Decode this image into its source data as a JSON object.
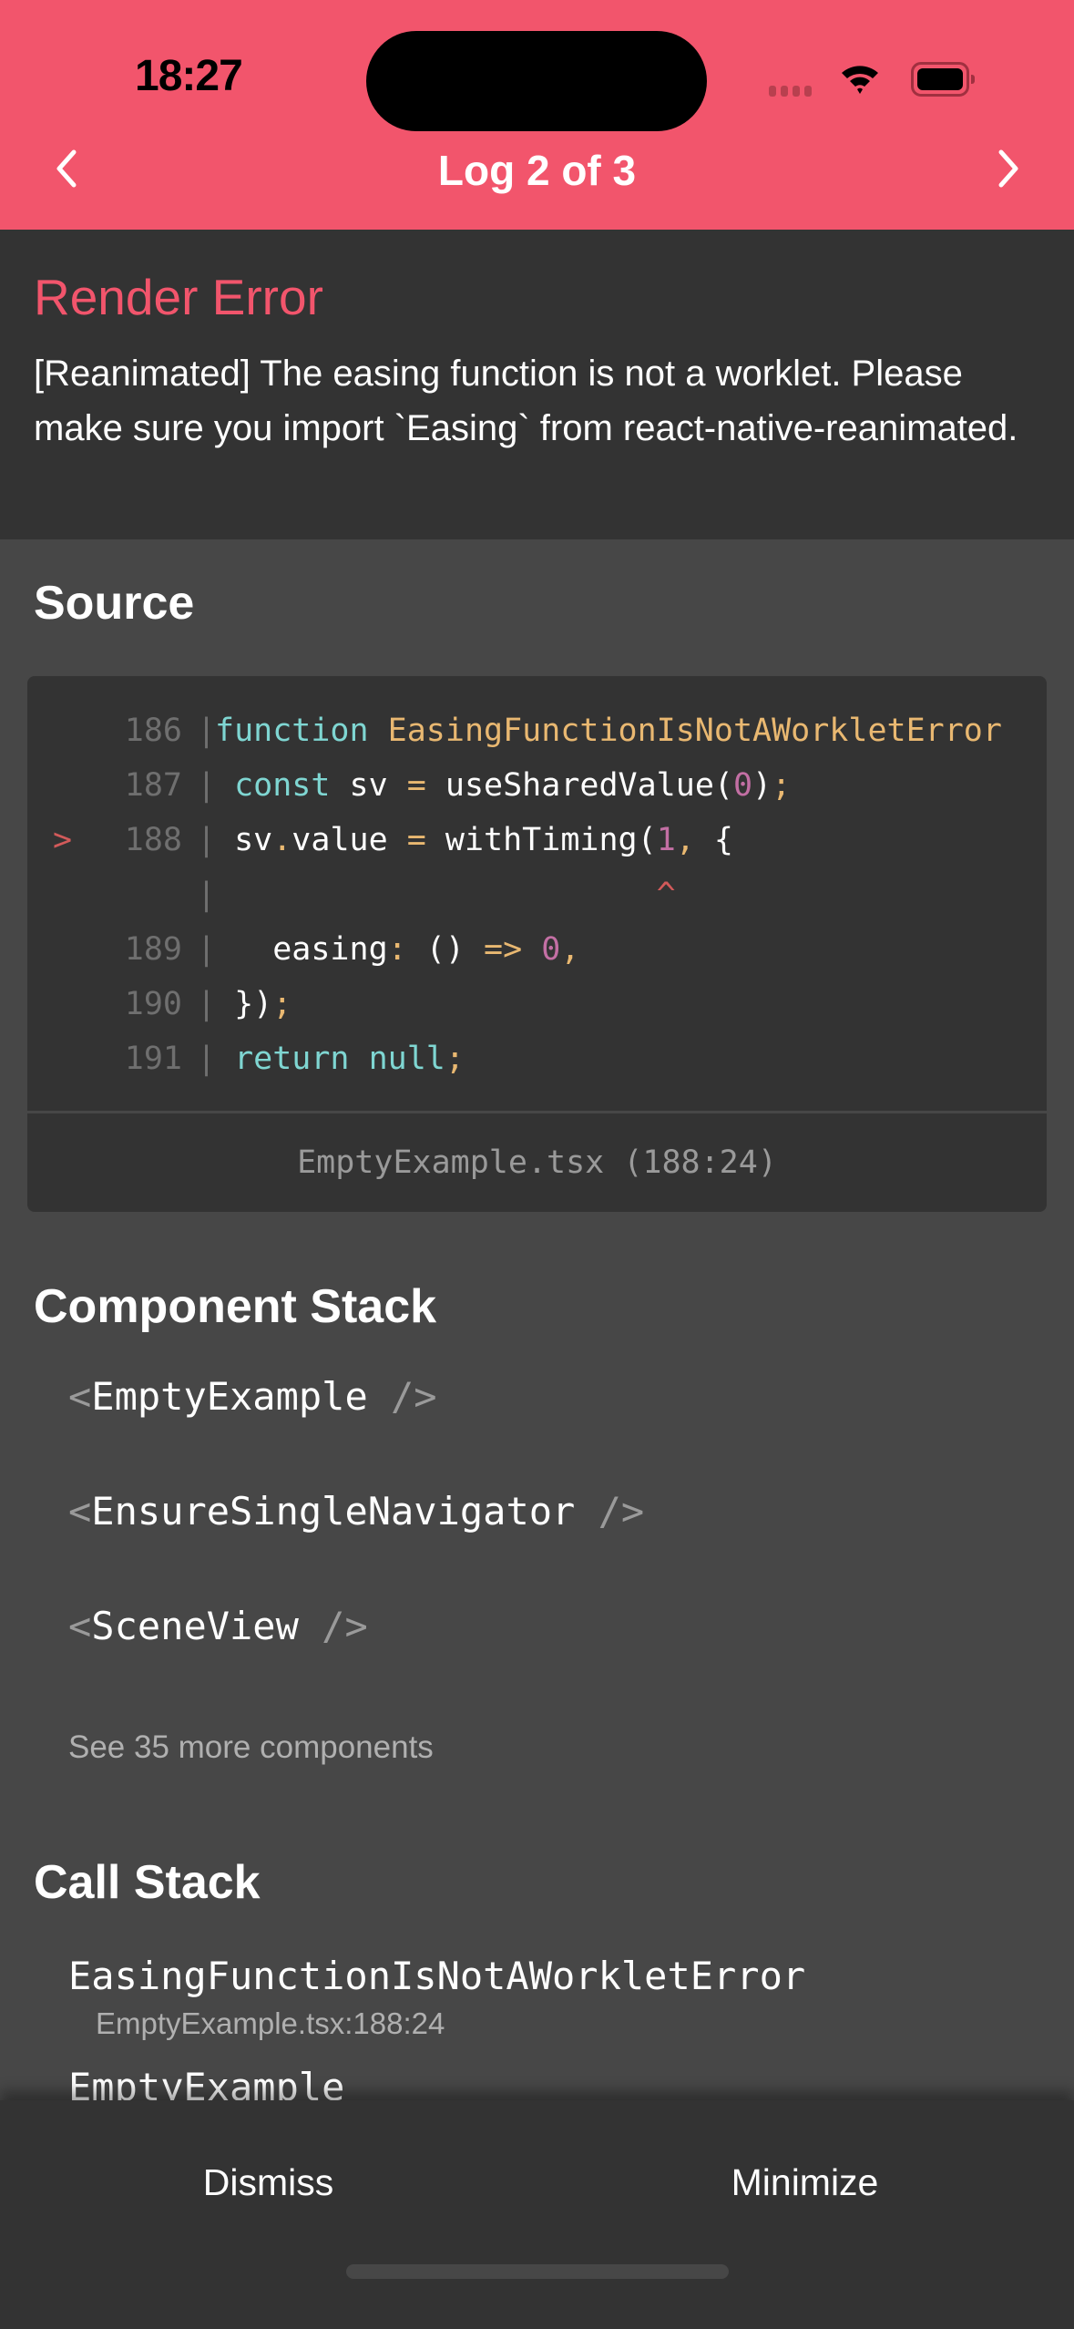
{
  "status_bar": {
    "time": "18:27",
    "icons": [
      "cellular-signal-icon",
      "wifi-icon",
      "battery-icon"
    ]
  },
  "header": {
    "title": "Log 2 of 3",
    "prev_icon": "chevron-left-icon",
    "next_icon": "chevron-right-icon",
    "accent_color": "#f2556c"
  },
  "error": {
    "type": "Render Error",
    "message": "[Reanimated] The easing function is not a worklet. Please make sure you import `Easing` from react-native-reanimated."
  },
  "source": {
    "title": "Source",
    "lines": [
      {
        "marker": "",
        "number": "186",
        "code": "function EasingFunctionIsNotAWorkletError"
      },
      {
        "marker": "",
        "number": "187",
        "code": " const sv = useSharedValue(0);"
      },
      {
        "marker": ">",
        "number": "188",
        "code": " sv.value = withTiming(1, {"
      },
      {
        "marker": "",
        "number": "",
        "code": "                       ^"
      },
      {
        "marker": "",
        "number": "189",
        "code": "   easing: () => 0,"
      },
      {
        "marker": "",
        "number": "190",
        "code": " });"
      },
      {
        "marker": "",
        "number": "191",
        "code": " return null;"
      }
    ],
    "file": "EmptyExample.tsx (188:24)"
  },
  "component_stack": {
    "title": "Component Stack",
    "items": [
      {
        "open": "<",
        "name": "EmptyExample",
        "close": " />"
      },
      {
        "open": "<",
        "name": "EnsureSingleNavigator",
        "close": " />"
      },
      {
        "open": "<",
        "name": "SceneView",
        "close": " />"
      }
    ],
    "see_more": "See 35 more components"
  },
  "call_stack": {
    "title": "Call Stack",
    "frames": [
      {
        "name": "EasingFunctionIsNotAWorkletError",
        "location": "EmptyExample.tsx:188:24"
      },
      {
        "name": "EmptyExample",
        "location": ""
      }
    ]
  },
  "footer": {
    "dismiss": "Dismiss",
    "minimize": "Minimize"
  }
}
